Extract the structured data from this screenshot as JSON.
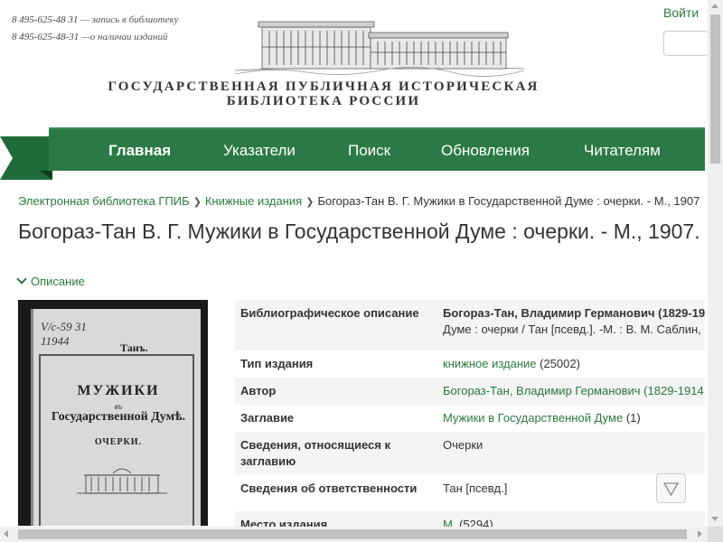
{
  "colors": {
    "accent": "#2b7a45",
    "link": "#2a7a3e"
  },
  "header": {
    "phones": [
      {
        "number": "8 495-625-48 31",
        "note": " — запись в библиотеку"
      },
      {
        "number": "8 495-625-48-31",
        "note": " —о наличаи изданий"
      }
    ],
    "library_title_line1": "ГОСУДАРСТВЕННАЯ ПУБЛИЧНАЯ ИСТОРИЧЕСКАЯ",
    "library_title_line2": "БИБЛИОТЕКА РОССИИ",
    "login_label": "Войти",
    "search_placeholder": ""
  },
  "nav": {
    "items": [
      {
        "label": "Главная",
        "active": true
      },
      {
        "label": "Указатели"
      },
      {
        "label": "Поиск"
      },
      {
        "label": "Обновления"
      },
      {
        "label": "Читателям"
      }
    ]
  },
  "breadcrumb": {
    "items": [
      "Электронная библиотека ГПИБ",
      "Книжные издания"
    ],
    "current": "Богораз-Тан В. Г. Мужики в Государственной Думе : очерки. - М., 1907"
  },
  "page_title": "Богораз-Тан В. Г. Мужики в Государственной Думе : очерки. - М., 1907.",
  "description_toggle": "Описание",
  "cover": {
    "stamp": "V/c-59",
    "stamp2": "31",
    "stamp3": "11944",
    "author": "Танъ.",
    "title1": "МУЖИКИ",
    "title2": "въ",
    "title3": "Государственной Думѣ.",
    "subtitle": "ОЧЕРКИ."
  },
  "details": {
    "rows": [
      {
        "key": "Библиографическое описание",
        "value_bold": "Богораз-Тан, Владимир Германович (1829-19",
        "value_line2": "Думе : очерки / Тан [псевд.]. -М. : В. М. Саблин,"
      },
      {
        "key": "Тип издания",
        "link": "книжное издание",
        "count": " (25002)"
      },
      {
        "key": "Автор",
        "link": "Богораз-Тан, Владимир Германович (1829-1914"
      },
      {
        "key": "Заглавие",
        "link": "Мужики в Государственной Думе",
        "count": " (1)"
      },
      {
        "key": "Сведения, относящиеся к заглавию",
        "value": "Очерки"
      },
      {
        "key": "Сведения об ответственности",
        "value": "Тан [псевд.]"
      },
      {
        "key": "Место издания",
        "link": "М.",
        "count": " (5294)"
      }
    ]
  }
}
